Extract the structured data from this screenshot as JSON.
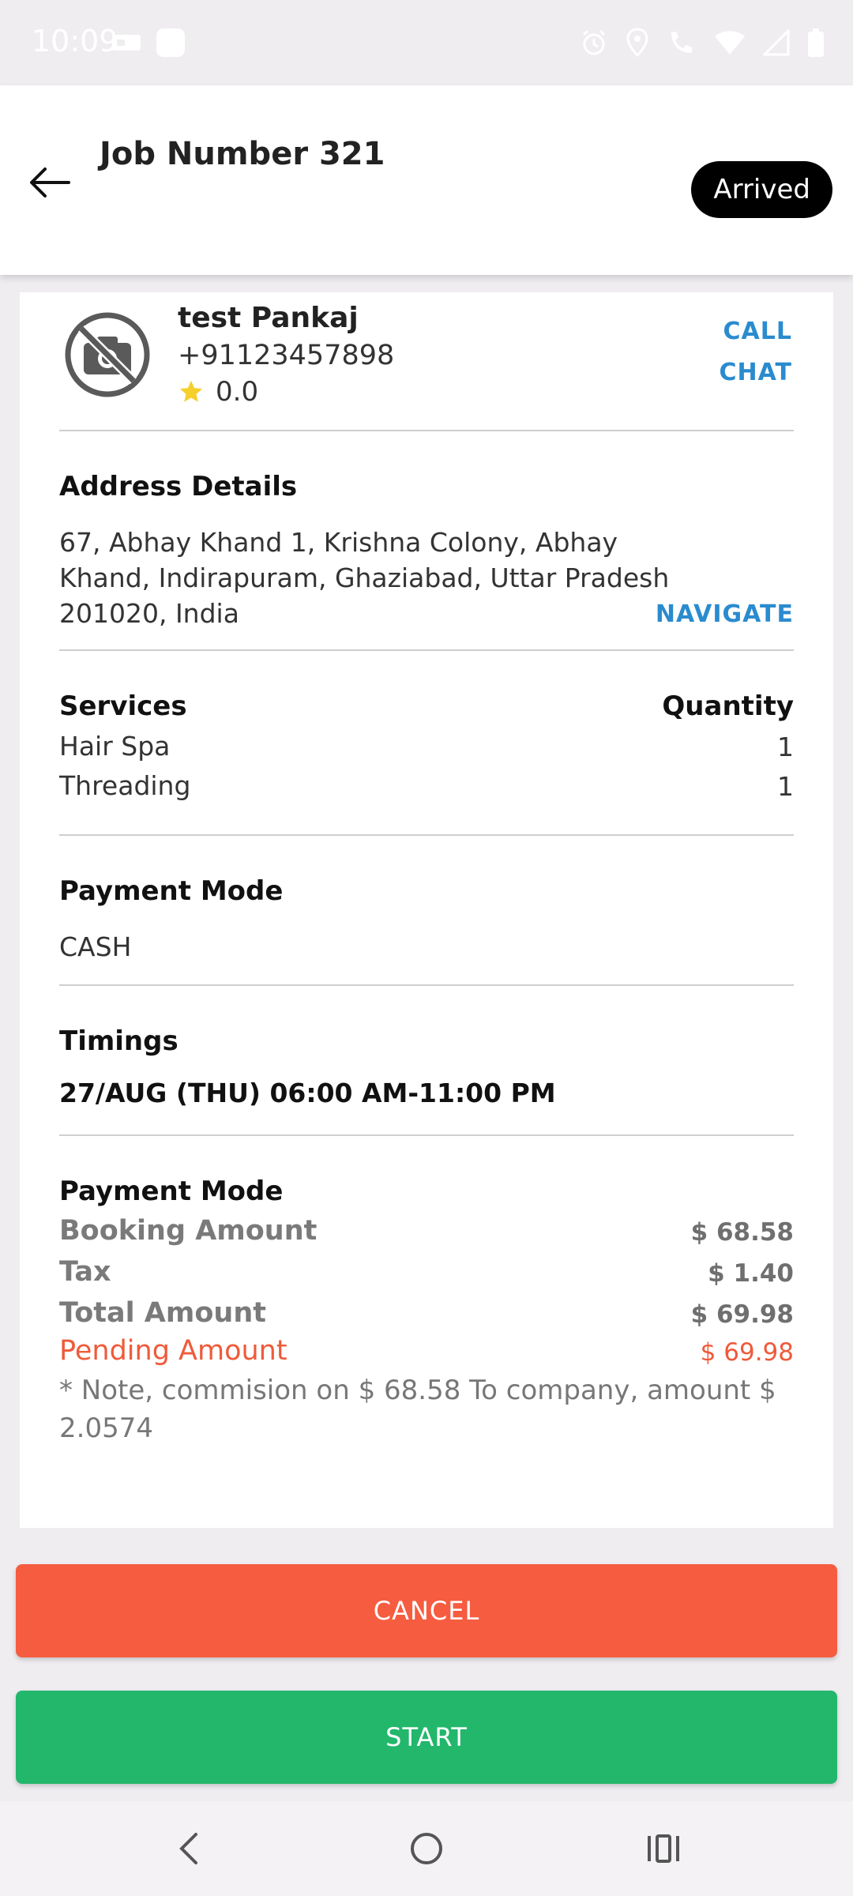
{
  "status_bar": {
    "time": "10:09"
  },
  "header": {
    "title": "Job Number 321",
    "status": "Arrived"
  },
  "customer": {
    "name": "test Pankaj",
    "phone": "+91123457898",
    "rating": "0.0",
    "call_label": "CALL",
    "chat_label": "CHAT"
  },
  "address": {
    "title": "Address Details",
    "lines": [
      "67, Abhay Khand 1, Krishna Colony, Abhay",
      "Khand, Indirapuram, Ghaziabad, Uttar Pradesh",
      "201020, India"
    ],
    "navigate_label": "NAVIGATE"
  },
  "services": {
    "title": "Services",
    "quantity_header": "Quantity",
    "items": [
      {
        "name": "Hair Spa",
        "qty": "1"
      },
      {
        "name": "Threading",
        "qty": "1"
      }
    ]
  },
  "payment_mode": {
    "title": "Payment Mode",
    "value": "CASH"
  },
  "timings": {
    "title": "Timings",
    "value": "27/AUG (THU) 06:00 AM-11:00 PM"
  },
  "billing": {
    "title": "Payment Mode",
    "booking_label": "Booking Amount",
    "booking_value": "$ 68.58",
    "tax_label": "Tax",
    "tax_value": "$ 1.40",
    "total_label": "Total Amount",
    "total_value": "$ 69.98",
    "pending_label": "Pending Amount",
    "pending_value": "$ 69.98",
    "note_lines": [
      "* Note, commision on $ 68.58 To company, amount $",
      "2.0574"
    ]
  },
  "actions": {
    "cancel_label": "CANCEL",
    "start_label": "START"
  },
  "colors": {
    "accent_blue": "#2a8bcf",
    "cancel": "#f65c40",
    "start": "#22b76b",
    "pending": "#ef5a3a"
  }
}
